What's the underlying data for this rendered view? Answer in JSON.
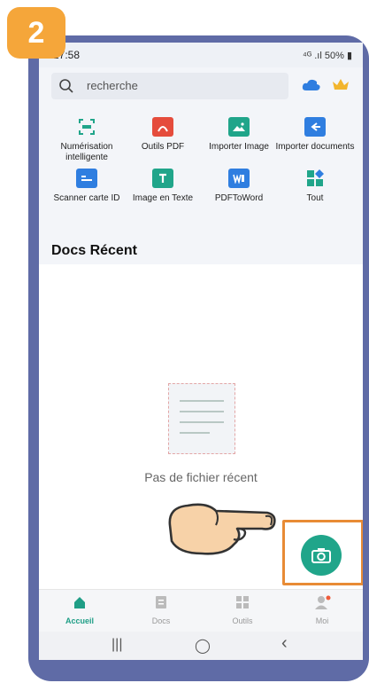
{
  "step": {
    "number": "2"
  },
  "status_bar": {
    "time": "17:58",
    "signal": "⁴ᴳ .ıl",
    "battery": "50%"
  },
  "search": {
    "placeholder": "recherche"
  },
  "tools": [
    {
      "label": "Numérisation intelligente",
      "icon": "scan-icon"
    },
    {
      "label": "Outils PDF",
      "icon": "pdf-icon"
    },
    {
      "label": "Importer Image",
      "icon": "image-icon"
    },
    {
      "label": "Importer documents",
      "icon": "import-documents-icon"
    },
    {
      "label": "Scanner carte ID",
      "icon": "id-card-icon"
    },
    {
      "label": "Image en Texte",
      "icon": "text-icon"
    },
    {
      "label": "PDFToWord",
      "icon": "word-icon"
    },
    {
      "label": "Tout",
      "icon": "all-icon"
    }
  ],
  "recent": {
    "title": "Docs Récent",
    "empty_text": "Pas de fichier récent"
  },
  "bottom_nav": [
    {
      "label": "Accueil",
      "icon": "home-icon",
      "active": true
    },
    {
      "label": "Docs",
      "icon": "docs-icon",
      "active": false
    },
    {
      "label": "Outils",
      "icon": "tools-icon",
      "active": false
    },
    {
      "label": "Moi",
      "icon": "profile-icon",
      "active": false
    }
  ],
  "system_nav": {
    "recents": "|||",
    "home": "◯",
    "back": "‹"
  },
  "colors": {
    "accent": "#20a58a",
    "badge": "#f5a63a",
    "highlight": "#e88b35",
    "frame": "#5f6ba6"
  }
}
